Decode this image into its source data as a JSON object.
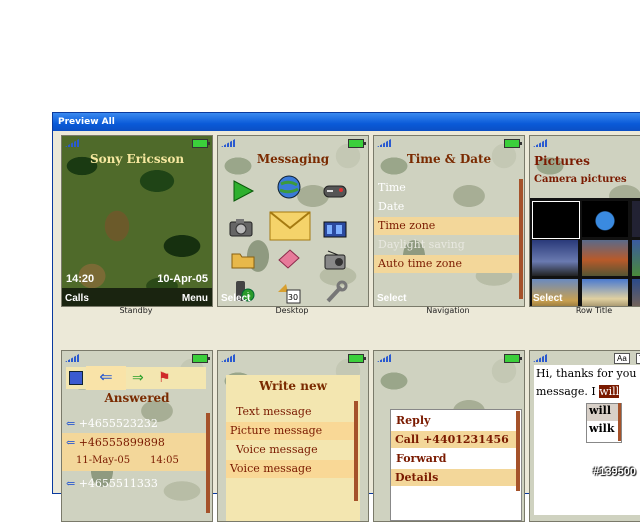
{
  "window": {
    "title": "Preview All"
  },
  "cells": {
    "standby": {
      "caption": "Standby",
      "operator": "Sony Ericsson",
      "time": "14:20",
      "date": "10-Apr-05",
      "left_soft": "Calls",
      "right_soft": "Menu"
    },
    "desktop": {
      "caption": "Desktop",
      "title": "Messaging",
      "left_soft": "Select"
    },
    "navigation": {
      "caption": "Navigation",
      "title": "Time & Date",
      "items": [
        "Time",
        "Date",
        "Time zone",
        "Daylight saving",
        "Auto time zone"
      ],
      "selected_index": 2,
      "left_soft": "Select"
    },
    "rowtitle": {
      "caption": "Row Title",
      "title": "Pictures",
      "subtitle": "Camera pictures",
      "left_soft": "Select"
    },
    "calls": {
      "title": "Answered",
      "entries": [
        "+4655523232",
        "+46555899898",
        "+4655511333"
      ],
      "entry_date": "11-May-05",
      "entry_time": "14:05"
    },
    "write": {
      "title": "Write new",
      "items": [
        "Text message",
        "Picture message",
        "Voice message",
        "Voice message"
      ]
    },
    "popup": {
      "items": [
        "Reply",
        "Call +4401231456",
        "Forward",
        "Details"
      ]
    },
    "t9": {
      "btn1": "Aa",
      "btn2": "T",
      "line1": "Hi, thanks for you",
      "line2_prefix": "message. I ",
      "word": "will",
      "candidates": [
        "will",
        "wilk"
      ]
    }
  },
  "watermark": "#139500"
}
